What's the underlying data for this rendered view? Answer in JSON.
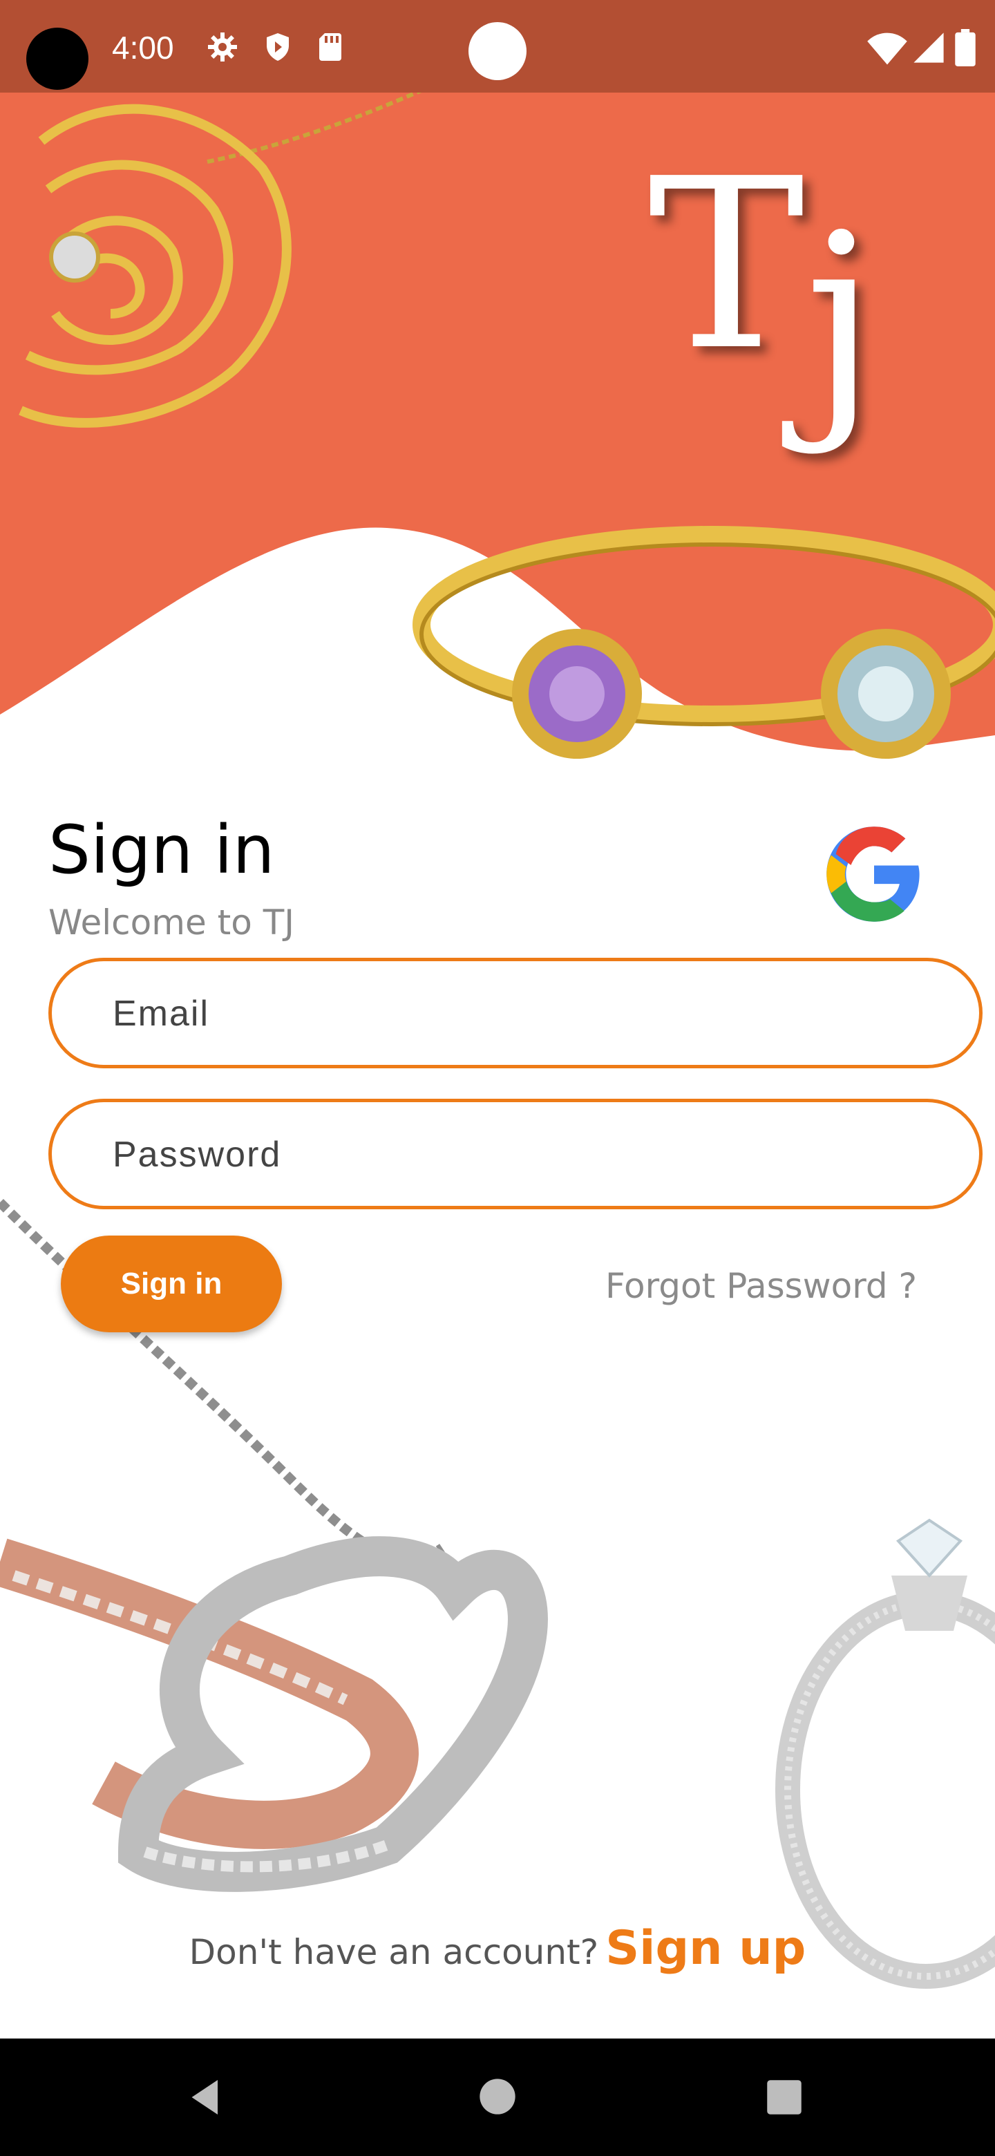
{
  "status_bar": {
    "time": "4:00",
    "icons": [
      "settings-icon",
      "shield-icon",
      "sd-card-icon",
      "wifi-icon",
      "signal-icon",
      "battery-icon"
    ]
  },
  "brand": {
    "logo_t": "T",
    "logo_j": "j"
  },
  "signin": {
    "title": "Sign in",
    "subtitle": "Welcome to TJ",
    "google_icon": "google-icon"
  },
  "form": {
    "email_placeholder": "Email",
    "password_placeholder": "Password",
    "submit_label": "Sign in",
    "forgot_label": "Forgot Password ?"
  },
  "footer": {
    "prompt": "Don't have an account?",
    "signup_label": "Sign up"
  },
  "colors": {
    "status_bar": "#b34f33",
    "hero": "#ed6a4a",
    "accent": "#ee7b17"
  },
  "nav": {
    "icons": [
      "back-icon",
      "home-icon",
      "recents-icon"
    ]
  }
}
